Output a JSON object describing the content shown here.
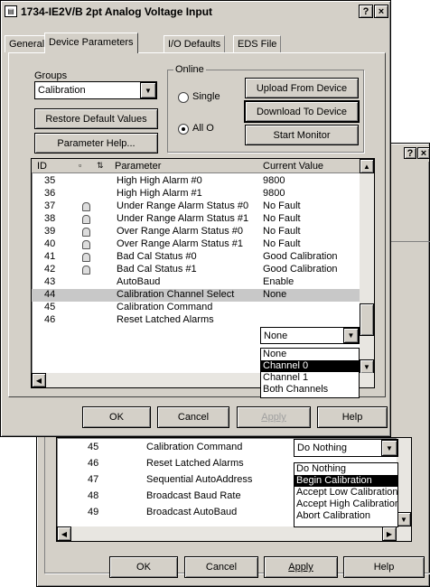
{
  "front": {
    "title": "1734-IE2V/B 2pt Analog Voltage Input",
    "help_glyph": "?",
    "close_glyph": "×",
    "tabs": [
      "General",
      "Device Parameters",
      "I/O Defaults",
      "EDS File"
    ],
    "groups_label": "Groups",
    "groups_value": "Calibration",
    "restore_label": "Restore Default Values",
    "param_help_label": "Parameter Help...",
    "online_label": "Online",
    "single_label": "Single",
    "all_label": "All O",
    "upload_label": "Upload From Device",
    "download_label": "Download To Device",
    "start_monitor_label": "Start Monitor",
    "columns": [
      "ID",
      "Parameter",
      "Current Value"
    ],
    "rows": [
      {
        "id": "35",
        "lock": false,
        "name": "High High Alarm #0",
        "value": "9800"
      },
      {
        "id": "36",
        "lock": false,
        "name": "High High Alarm #1",
        "value": "9800"
      },
      {
        "id": "37",
        "lock": true,
        "name": "Under Range Alarm Status #0",
        "value": "No Fault"
      },
      {
        "id": "38",
        "lock": true,
        "name": "Under Range Alarm Status #1",
        "value": "No Fault"
      },
      {
        "id": "39",
        "lock": true,
        "name": "Over Range Alarm Status #0",
        "value": "No Fault"
      },
      {
        "id": "40",
        "lock": true,
        "name": "Over Range Alarm Status #1",
        "value": "No Fault"
      },
      {
        "id": "41",
        "lock": true,
        "name": "Bad Cal Status #0",
        "value": "Good Calibration"
      },
      {
        "id": "42",
        "lock": true,
        "name": "Bad Cal Status #1",
        "value": "Good Calibration"
      },
      {
        "id": "43",
        "lock": false,
        "name": "AutoBaud",
        "value": "Enable"
      },
      {
        "id": "44",
        "lock": false,
        "name": "Calibration Channel Select",
        "value": "None"
      },
      {
        "id": "45",
        "lock": false,
        "name": "Calibration Command",
        "value": ""
      },
      {
        "id": "46",
        "lock": false,
        "name": "Reset Latched Alarms",
        "value": ""
      }
    ],
    "dropdown_value": "None",
    "dropdown_options": [
      "None",
      "Channel 0",
      "Channel 1",
      "Both Channels"
    ],
    "dropdown_selected": "Channel 0",
    "ok_label": "OK",
    "cancel_label": "Cancel",
    "apply_label": "Apply",
    "help_label": "Help"
  },
  "back": {
    "help_glyph": "?",
    "close_glyph": "×",
    "rows": [
      {
        "id": "45",
        "name": "Calibration Command"
      },
      {
        "id": "46",
        "name": "Reset Latched Alarms"
      },
      {
        "id": "47",
        "name": "Sequential AutoAddress"
      },
      {
        "id": "48",
        "name": "Broadcast Baud Rate"
      },
      {
        "id": "49",
        "name": "Broadcast AutoBaud"
      }
    ],
    "dropdown_value": "Do Nothing",
    "dropdown_options": [
      "Do Nothing",
      "Begin Calibration",
      "Accept Low Calibration",
      "Accept High Calibration",
      "Abort Calibration"
    ],
    "dropdown_selected": "Begin Calibration",
    "ok_label": "OK",
    "cancel_label": "Cancel",
    "apply_label": "Apply",
    "help_label": "Help"
  }
}
